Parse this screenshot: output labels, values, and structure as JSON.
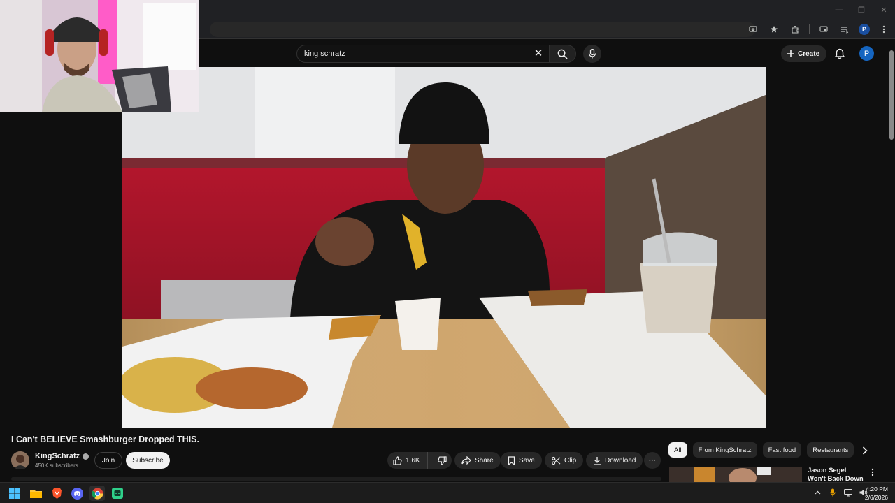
{
  "browser": {
    "window_controls": [
      "—",
      "❐",
      "✕"
    ]
  },
  "youtube": {
    "search": {
      "value": "king schratz",
      "placeholder": "Search"
    },
    "create_label": "Create",
    "avatar_letter": "P",
    "video": {
      "title": "I Can't BELIEVE Smashburger Dropped THIS.",
      "channel_name": "KingSchratz",
      "subscribers": "450K subscribers",
      "join_label": "Join",
      "subscribe_label": "Subscribe",
      "like_count": "1.6K",
      "share_label": "Share",
      "save_label": "Save",
      "clip_label": "Clip",
      "download_label": "Download",
      "more_label": "···"
    },
    "chips": [
      "All",
      "From KingSchratz",
      "Fast food",
      "Restaurants"
    ],
    "recommendation": {
      "title": "Jason Segel Won't Back Down While"
    }
  },
  "taskbar": {
    "time": "4:20 PM",
    "date": "2/6/2026"
  },
  "colors": {
    "background": "#0f0f0f",
    "chip_bg": "#272727",
    "accent_blue": "#1565c0"
  }
}
